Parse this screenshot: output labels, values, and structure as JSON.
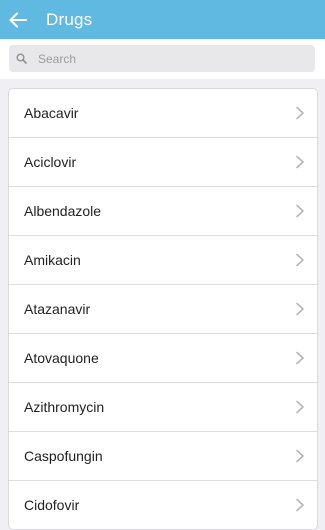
{
  "header": {
    "title": "Drugs",
    "back_icon": "arrow-left-icon"
  },
  "search": {
    "placeholder": "Search",
    "value": "",
    "icon": "search-icon"
  },
  "drugs": [
    {
      "label": "Abacavir"
    },
    {
      "label": "Aciclovir"
    },
    {
      "label": "Albendazole"
    },
    {
      "label": "Amikacin"
    },
    {
      "label": "Atazanavir"
    },
    {
      "label": "Atovaquone"
    },
    {
      "label": "Azithromycin"
    },
    {
      "label": "Caspofungin"
    },
    {
      "label": "Cidofovir"
    }
  ],
  "colors": {
    "app_bar": "#5fb9e0",
    "background": "#efeff4",
    "chevron": "#b5b5ba"
  }
}
